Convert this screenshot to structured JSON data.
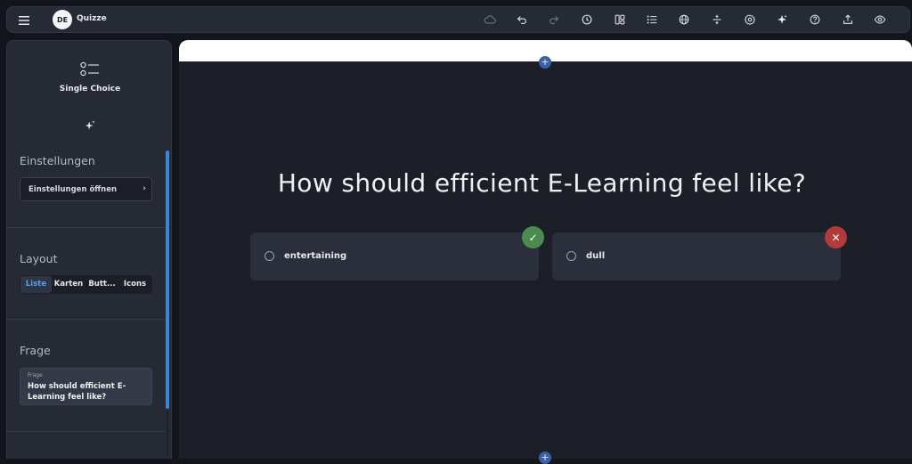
{
  "header": {
    "logo_text": "DE",
    "app_name": "Quizze",
    "icons": [
      "cloud-icon",
      "undo-icon",
      "redo-icon",
      "history-icon",
      "layout-icon",
      "list-icon",
      "globe-icon",
      "split-icon",
      "settings-icon",
      "sparkle-icon",
      "help-icon",
      "share-icon",
      "preview-icon"
    ]
  },
  "sidebar": {
    "type_label": "Single Choice",
    "settings_heading": "Einstellungen",
    "open_settings_label": "Einstellungen öffnen",
    "open_settings_chevron": "›",
    "layout_heading": "Layout",
    "layout_options": [
      "Liste",
      "Karten",
      "Butt...",
      "Icons"
    ],
    "layout_selected": "Liste",
    "question_heading": "Frage",
    "question_field_label": "Frage",
    "question_field_value": "How should efficient E-Learning feel like?"
  },
  "main": {
    "add_label": "+",
    "question": "How should efficient E-Learning feel like?",
    "answers": [
      {
        "text": "entertaining",
        "status": "correct",
        "badge": "✓"
      },
      {
        "text": "dull",
        "status": "incorrect",
        "badge": "✕"
      }
    ]
  },
  "colors": {
    "accent": "#3c86d8",
    "correct": "#4b8b4e",
    "incorrect": "#b13a3a",
    "background": "#1c1f27"
  }
}
